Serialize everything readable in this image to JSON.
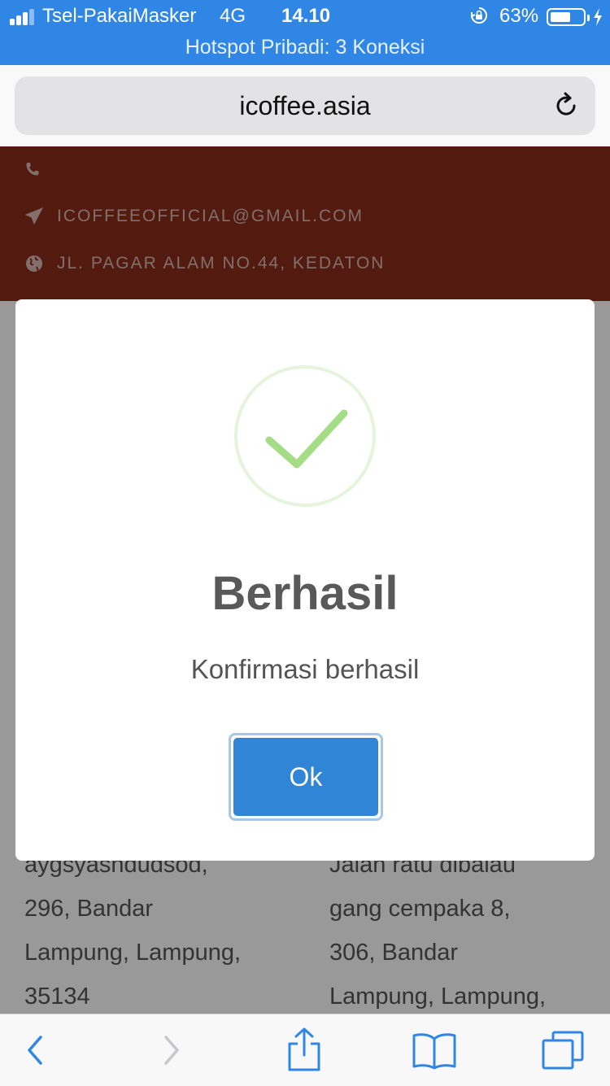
{
  "status_bar": {
    "carrier": "Tsel-PakaiMasker",
    "network": "4G",
    "time": "14.10",
    "battery_percent": "63%",
    "battery_level": 0.63,
    "hotspot": "Hotspot Pribadi: 3 Koneksi",
    "color": "#2f86e5"
  },
  "browser": {
    "url": "icoffee.asia"
  },
  "site_header": {
    "email": "ICOFFEEOFFICIAL@GMAIL.COM",
    "address": "JL. PAGAR ALAM NO.44, KEDATON",
    "color": "#8a2c1b"
  },
  "content": {
    "address_left": [
      "aygsyashdudsod,",
      "296, Bandar",
      "Lampung, Lampung,",
      "35134"
    ],
    "address_right": [
      "Jalan ratu dibalau",
      "gang cempaka 8,",
      "306, Bandar",
      "Lampung, Lampung,"
    ]
  },
  "modal": {
    "title": "Berhasil",
    "text": "Konfirmasi berhasil",
    "ok_label": "Ok",
    "accent": "#3085d6",
    "success_color": "#a5dc86",
    "icon": "success-check-icon"
  }
}
